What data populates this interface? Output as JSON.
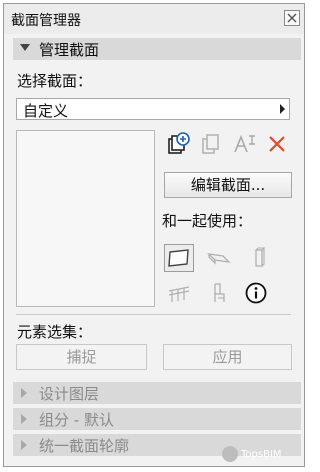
{
  "window": {
    "title": "截面管理器"
  },
  "manage_section": {
    "header": "管理截面",
    "select_label": "选择截面：",
    "dropdown_value": "自定义",
    "edit_button": "编辑截面...",
    "use_with_label": "和一起使用：",
    "elements_label": "元素选集：",
    "capture_button": "捕捉",
    "apply_button": "应用"
  },
  "collapsed_sections": [
    "设计图层",
    "组分 - 默认",
    "统一截面轮廓"
  ],
  "icons": {
    "toolbar": [
      "new-section-icon",
      "duplicate-icon",
      "rename-icon",
      "delete-icon"
    ],
    "use_with": [
      "wall-icon",
      "beam-icon",
      "column-icon",
      "railing-icon",
      "chair-icon",
      "info-icon"
    ]
  },
  "colors": {
    "accent_blue": "#1f5fb3",
    "delete_red": "#e04a2a",
    "header_bg": "#d9d9d9"
  },
  "watermark": "TopsBIM"
}
